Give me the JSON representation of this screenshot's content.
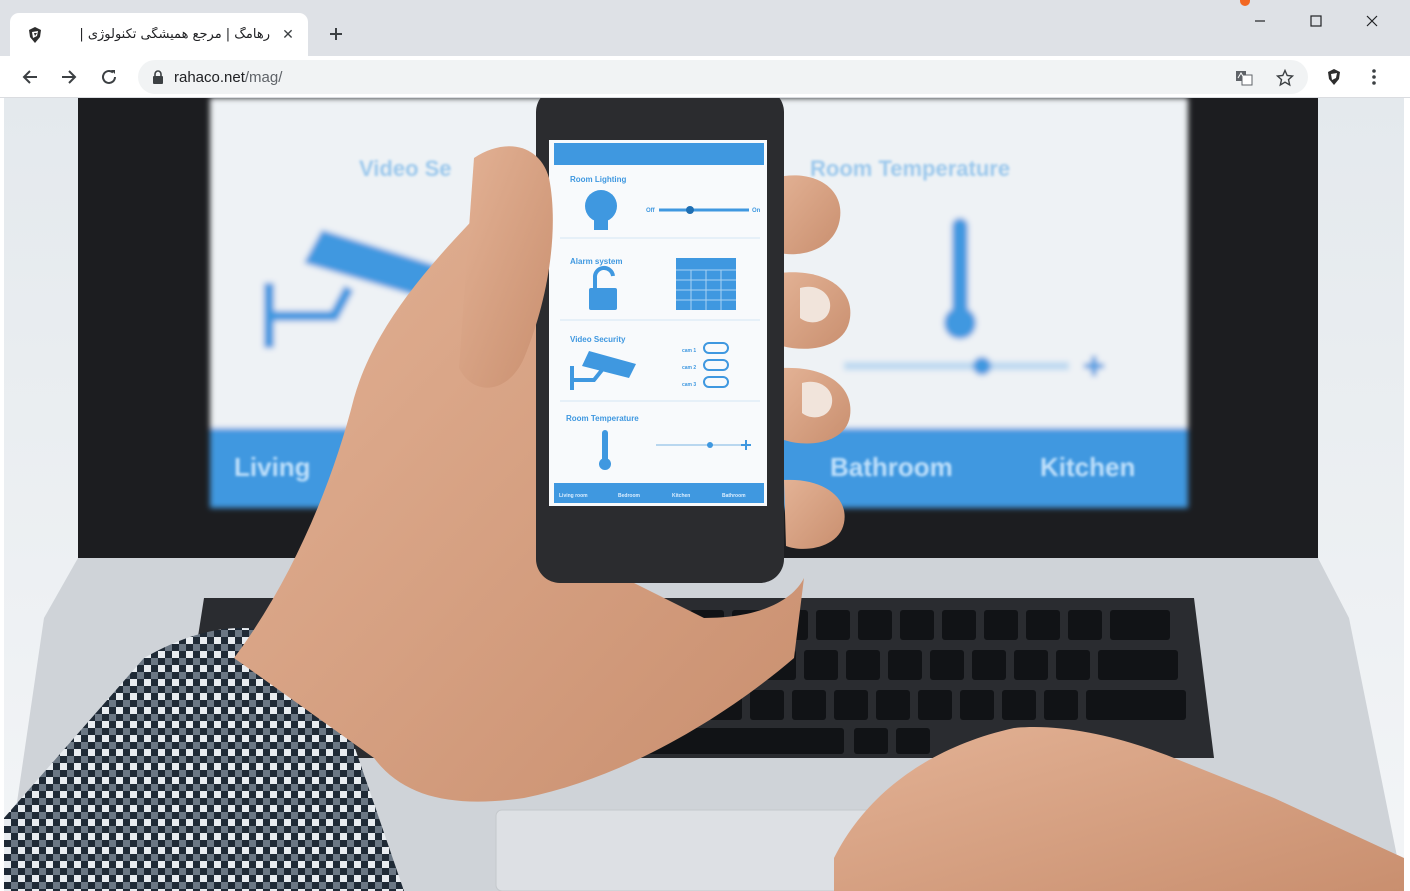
{
  "window": {
    "tab": {
      "title": "رهامگ | مرجع همیشگی تکنولوژی |",
      "favicon": "rahaco-logo-icon",
      "close_icon": "close-icon"
    },
    "new_tab_icon": "plus-icon",
    "controls": {
      "minimize": "minimize-icon",
      "maximize": "maximize-icon",
      "close": "close-icon"
    }
  },
  "toolbar": {
    "back_icon": "arrow-left-icon",
    "forward_icon": "arrow-right-icon",
    "reload_icon": "reload-icon",
    "lock_icon": "lock-icon",
    "url_host": "rahaco.net",
    "url_path": "/mag/",
    "translate_icon": "translate-icon",
    "bookmark_icon": "star-icon",
    "extension_icon": "rahaco-extension-icon",
    "menu_icon": "kebab-menu-icon"
  },
  "page": {
    "laptop_screen": {
      "left_heading": "Video Se",
      "right_heading": "Room Temperature",
      "tabs": [
        "Living",
        "Bathroom",
        "Kitchen"
      ]
    },
    "phone_app": {
      "sections": [
        {
          "title": "Room Lighting",
          "icon": "lightbulb-icon",
          "slider_off": "Off",
          "slider_on": "On"
        },
        {
          "title": "Alarm system",
          "icon": "unlock-icon",
          "keypad_icon": "keypad-icon"
        },
        {
          "title": "Video Security",
          "icon": "security-camera-icon",
          "toggles": [
            "cam 1",
            "cam 2",
            "cam 3"
          ]
        },
        {
          "title": "Room Temperature",
          "icon": "thermometer-icon"
        }
      ],
      "bottom_tabs": [
        "Living room",
        "Bedroom",
        "Kitchen",
        "Bathroom"
      ]
    },
    "colors": {
      "accent_blue": "#3f98e0",
      "tab_bar": "#dee1e6",
      "omnibox": "#f1f3f4"
    }
  }
}
